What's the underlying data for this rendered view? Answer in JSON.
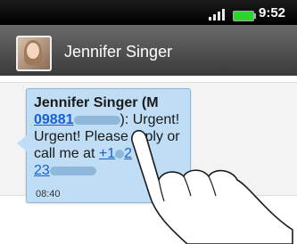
{
  "status_bar": {
    "time": "9:52",
    "signal_icon": "signal-bars-icon",
    "battery_icon": "battery-icon"
  },
  "header": {
    "contact_name": "Jennifer Singer",
    "avatar": "contact-photo"
  },
  "message": {
    "sender_label": "Jennifer Singer (M",
    "sender_number_visible": "09881",
    "text_after_number": "): Urgent! Urgent! Please reply or call me at",
    "phone_link_part1": "+1",
    "phone_link_part2": "2",
    "phone_link_part3": "23",
    "timestamp": "08:40"
  },
  "colors": {
    "bubble": "#bfdef5",
    "link": "#1a5fd1",
    "header": "#4a4a4a"
  }
}
